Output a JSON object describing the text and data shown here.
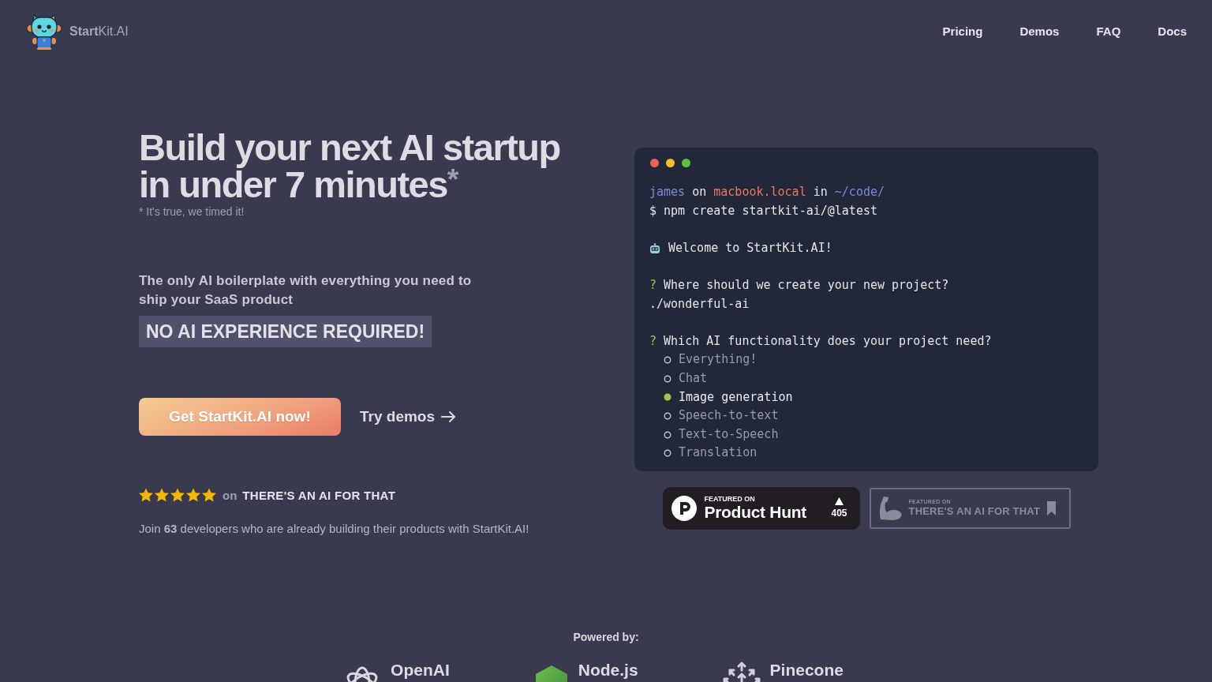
{
  "header": {
    "brand": "**Start**Kit.AI",
    "nav_links": [
      "Pricing",
      "Demos",
      "FAQ",
      "Docs"
    ]
  },
  "hero": {
    "headline": "Build your next AI startup in under 7 minutes$^{*}$",
    "footnote": "* It's true, we timed it!",
    "subtitle": "The only AI boilerplate with everything you need to ship your SaaS product",
    "highlight": "NO AI EXPERIENCE REQUIRED!",
    "primary_button": "Get StartKit.AI now!",
    "secondary_link": "Try demos",
    "rating": {
      "stars": 5,
      "connector": "on",
      "site": "THERE'S AN AI FOR THAT"
    },
    "social_proof": "Join **63** developers who are already building their products with StartKit.AI!"
  },
  "terminal": {
    "window_controls": [
      {
        "color": "#ee5f57"
      },
      {
        "color": "#f5bd2f"
      },
      {
        "color": "#5dc23f"
      }
    ],
    "prompt": [
      {
        "kind": "user",
        "text": "james"
      },
      {
        "kind": "plain",
        "text": "on"
      },
      {
        "kind": "host",
        "text": "macbook.local"
      },
      {
        "kind": "plain",
        "text": "in"
      },
      {
        "kind": "path",
        "text": "~/code/"
      }
    ],
    "command": "$ npm create startkit-ai/@latest",
    "welcome": "Welcome to StartKit.AI!",
    "questions": [
      {
        "mark": "?",
        "text": "Where should we create your new project?",
        "answer": "./wonderful-ai"
      },
      {
        "mark": "?",
        "text": "Which AI functionality does your project need?",
        "options": [
          {
            "label": "Everything!",
            "selected": false
          },
          {
            "label": "Chat",
            "selected": false
          },
          {
            "label": "Image generation",
            "selected": true
          },
          {
            "label": "Speech-to-text",
            "selected": false
          },
          {
            "label": "Text-to-Speech",
            "selected": false
          },
          {
            "label": "Translation",
            "selected": false
          }
        ]
      }
    ]
  },
  "badges": [
    {
      "kind": "product_hunt",
      "caption": "FEATURED ON",
      "name": "Product Hunt",
      "count": "405"
    },
    {
      "kind": "taaft",
      "caption": "FEATURED ON",
      "name": "THERE'S AN AI FOR THAT"
    }
  ],
  "powered_by": {
    "title": "Powered by:",
    "items": [
      {
        "kind": "openai",
        "name": "OpenAI"
      },
      {
        "kind": "nodejs",
        "name": "Node.js"
      },
      {
        "kind": "pinecone",
        "name": "Pinecone"
      }
    ]
  }
}
